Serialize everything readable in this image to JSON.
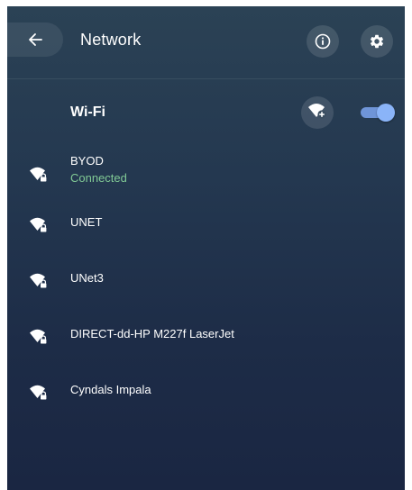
{
  "header": {
    "title": "Network",
    "back_icon": "arrow-left-icon",
    "info_icon": "info-icon",
    "settings_icon": "gear-icon"
  },
  "wifi": {
    "label": "Wi-Fi",
    "add_network_icon": "wifi-add-icon",
    "enabled": true
  },
  "networks": [
    {
      "name": "BYOD",
      "status": "Connected",
      "icon": "wifi-locked-icon"
    },
    {
      "name": "UNET",
      "icon": "wifi-locked-icon"
    },
    {
      "name": "UNet3",
      "icon": "wifi-locked-icon"
    },
    {
      "name": "DIRECT-dd-HP M227f LaserJet",
      "icon": "wifi-locked-icon"
    },
    {
      "name": "Cyndals Impala",
      "icon": "wifi-locked-icon"
    }
  ],
  "colors": {
    "panel_top": "#2b4255",
    "panel_bottom": "#1a2642",
    "accent": "#8ab4f8",
    "connected": "#81c995"
  }
}
